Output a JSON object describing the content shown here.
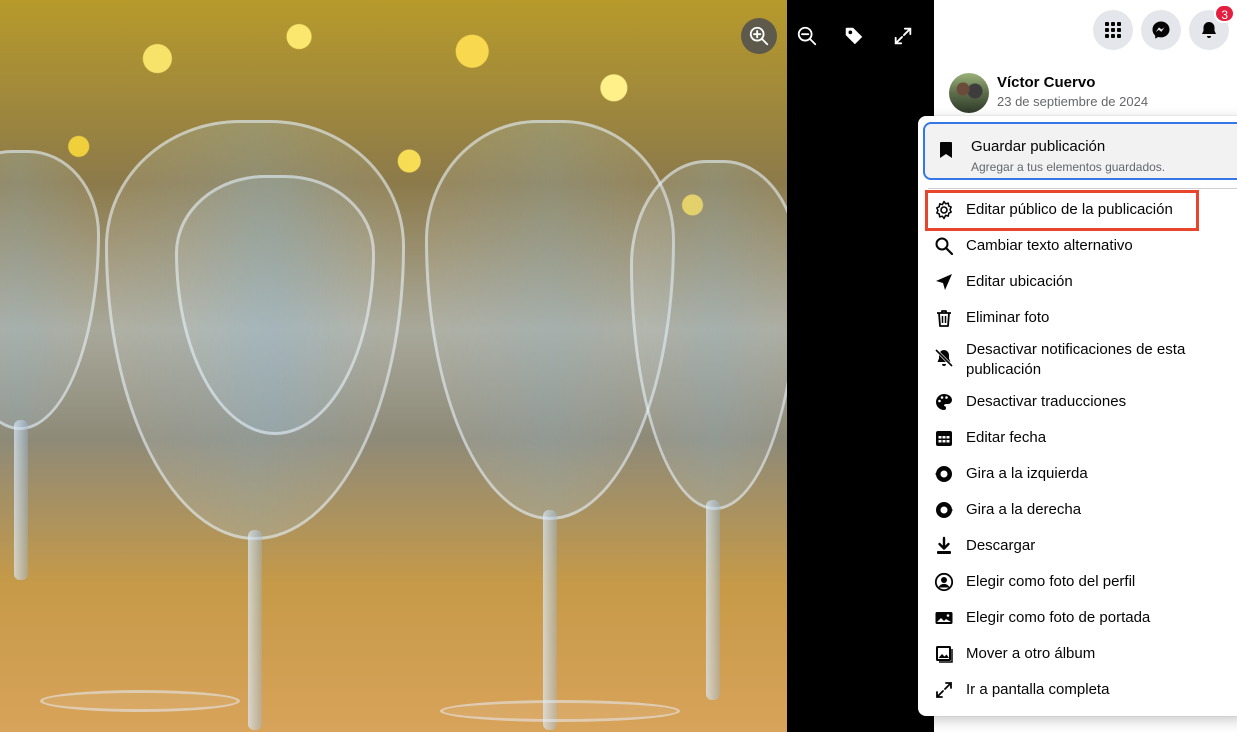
{
  "viewer": {
    "toolbar": [
      {
        "name": "zoom-in-icon"
      },
      {
        "name": "zoom-out-icon"
      },
      {
        "name": "tag-icon"
      },
      {
        "name": "fullscreen-icon"
      }
    ]
  },
  "header": {
    "notifications_count": "3"
  },
  "post": {
    "author_name": "Víctor Cuervo",
    "date": "23 de septiembre de 2024"
  },
  "menu": {
    "save": {
      "label": "Guardar publicación",
      "sublabel": "Agregar a tus elementos guardados."
    },
    "items": [
      {
        "label": "Editar público de la publicación",
        "icon": "gear-icon"
      },
      {
        "label": "Cambiar texto alternativo",
        "icon": "search-icon"
      },
      {
        "label": "Editar ubicación",
        "icon": "location-arrow-icon"
      },
      {
        "label": "Eliminar foto",
        "icon": "trash-icon"
      },
      {
        "label": "Desactivar notificaciones de esta",
        "label2": "publicación",
        "icon": "bell-off-icon"
      },
      {
        "label": "Desactivar traducciones",
        "icon": "translate-icon"
      },
      {
        "label": "Editar fecha",
        "icon": "calendar-icon"
      },
      {
        "label": "Gira a la izquierda",
        "icon": "rotate-left-icon"
      },
      {
        "label": "Gira a la derecha",
        "icon": "rotate-right-icon"
      },
      {
        "label": "Descargar",
        "icon": "download-icon"
      },
      {
        "label": "Elegir como foto del perfil",
        "icon": "profile-photo-icon"
      },
      {
        "label": "Elegir como foto de portada",
        "icon": "cover-photo-icon"
      },
      {
        "label": "Mover a otro álbum",
        "icon": "album-icon"
      },
      {
        "label": "Ir a pantalla completa",
        "icon": "expand-icon"
      }
    ]
  },
  "colors": {
    "highlight": "#e8452c",
    "focus_ring": "#3578e5",
    "badge": "#e41e3f"
  }
}
